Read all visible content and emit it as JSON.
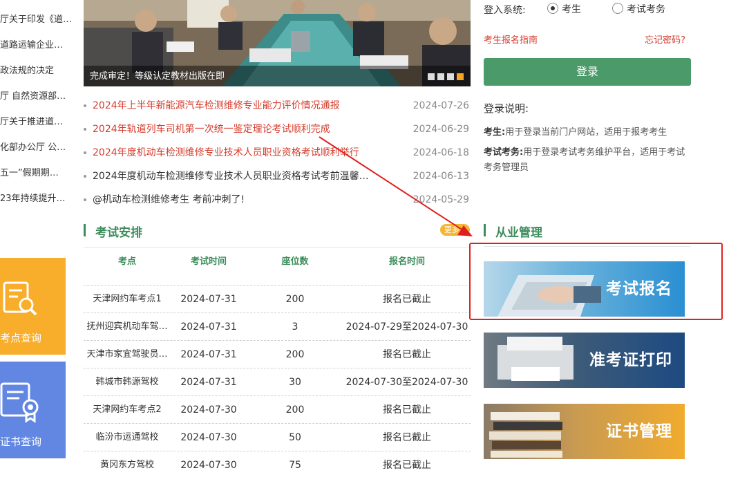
{
  "left_news": [
    "厅关于印发《道…",
    "道路运输企业…",
    "政法规的决定",
    "厅 自然资源部…",
    "厅关于推进道…",
    "化部办公厅 公…",
    "五一”假期期…",
    "23年持续提升…"
  ],
  "tiles": {
    "venue_query": "考点查询",
    "cert_query": "证书查询"
  },
  "slider": {
    "caption": "完成审定！等级认定教材出版在即",
    "active_dot": 4,
    "dot_count": 4
  },
  "news": [
    {
      "title": "2024年上半年新能源汽车检测维修专业能力评价情况通报",
      "date": "2024-07-26",
      "style": "red"
    },
    {
      "title": "2024年轨道列车司机第一次统一鉴定理论考试顺利完成",
      "date": "2024-06-29",
      "style": "red"
    },
    {
      "title": "2024年度机动车检测维修专业技术人员职业资格考试顺利举行",
      "date": "2024-06-18",
      "style": "red"
    },
    {
      "title": "2024年度机动车检测维修专业技术人员职业资格考试考前温馨…",
      "date": "2024-06-13",
      "style": "dark"
    },
    {
      "title": "@机动车检测维修考生 考前冲刺了!",
      "date": "2024-05-29",
      "style": "dark"
    }
  ],
  "exam_section": {
    "title": "考试安排",
    "more": "更多+",
    "columns": [
      "考点",
      "考试时间",
      "座位数",
      "报名时间"
    ],
    "rows": [
      [
        "天津网约车考点1",
        "2024-07-31",
        "200",
        "报名已截止"
      ],
      [
        "抚州迎宾机动车驾…",
        "2024-07-31",
        "3",
        "2024-07-29至2024-07-30"
      ],
      [
        "天津市家宜驾驶员…",
        "2024-07-31",
        "200",
        "报名已截止"
      ],
      [
        "韩城市韩源驾校",
        "2024-07-31",
        "30",
        "2024-07-30至2024-07-30"
      ],
      [
        "天津网约车考点2",
        "2024-07-30",
        "200",
        "报名已截止"
      ],
      [
        "临汾市运通驾校",
        "2024-07-30",
        "50",
        "报名已截止"
      ],
      [
        "黄冈东方驾校",
        "2024-07-30",
        "75",
        "报名已截止"
      ]
    ]
  },
  "login": {
    "system_label": "登入系统:",
    "option_candidate": "考生",
    "option_affairs": "考试考务",
    "selected": "考生",
    "guide_link": "考生报名指南",
    "forgot_link": "忘记密码?",
    "button": "登录",
    "desc_title": "登录说明:",
    "desc_candidate_key": "考生:",
    "desc_candidate_text": "用于登录当前门户网站，适用于报考考生",
    "desc_affairs_key": "考试考务:",
    "desc_affairs_text": "用于登录考试考务维护平台，适用于考试考务管理员"
  },
  "practice_section": {
    "title": "从业管理",
    "banners": [
      "考试报名",
      "准考证打印",
      "证书管理"
    ]
  },
  "colors": {
    "green": "#3c8c5b",
    "red": "#d53b2c",
    "orange": "#f8ad2b",
    "blue": "#6287e2",
    "annotation": "#e02020"
  }
}
